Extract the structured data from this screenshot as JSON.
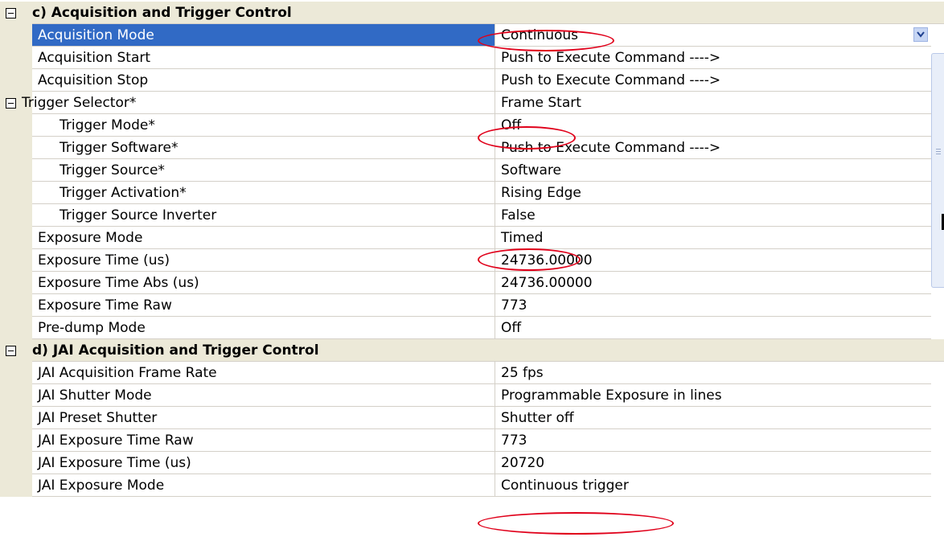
{
  "sections": [
    {
      "label": "c) Acquisition and Trigger Control",
      "rows": [
        {
          "name": "Acquisition Mode",
          "value": "Continuous"
        },
        {
          "name": "Acquisition Start",
          "value": "Push to Execute Command ---->"
        },
        {
          "name": "Acquisition Stop",
          "value": "Push to Execute Command ---->"
        },
        {
          "name": "Trigger Selector*",
          "value": "Frame Start"
        },
        {
          "name": "Trigger Mode*",
          "value": "Off"
        },
        {
          "name": "Trigger Software*",
          "value": "Push to Execute Command ---->"
        },
        {
          "name": "Trigger Source*",
          "value": "Software"
        },
        {
          "name": "Trigger Activation*",
          "value": "Rising Edge"
        },
        {
          "name": "Trigger Source Inverter",
          "value": "False"
        },
        {
          "name": "Exposure Mode",
          "value": "Timed"
        },
        {
          "name": "Exposure Time (us)",
          "value": "24736.00000"
        },
        {
          "name": "Exposure Time Abs (us)",
          "value": "24736.00000"
        },
        {
          "name": "Exposure Time Raw",
          "value": "773"
        },
        {
          "name": "Pre-dump Mode",
          "value": "Off"
        }
      ]
    },
    {
      "label": "d) JAI Acquisition and Trigger Control",
      "rows": [
        {
          "name": "JAI Acquisition Frame Rate",
          "value": "25 fps"
        },
        {
          "name": "JAI Shutter Mode",
          "value": "Programmable Exposure in lines"
        },
        {
          "name": "JAI Preset Shutter",
          "value": "Shutter off"
        },
        {
          "name": "JAI Exposure Time Raw",
          "value": "773"
        },
        {
          "name": "JAI Exposure Time (us)",
          "value": "20720"
        },
        {
          "name": "JAI Exposure Mode",
          "value": "Continuous trigger"
        }
      ]
    }
  ],
  "colors": {
    "selection": "#316ac5",
    "category_background": "#ece9d8",
    "highlight_oval": "#e0001a"
  },
  "icons": {
    "collapse": "minus-box-icon",
    "dropdown": "chevron-down-icon"
  }
}
